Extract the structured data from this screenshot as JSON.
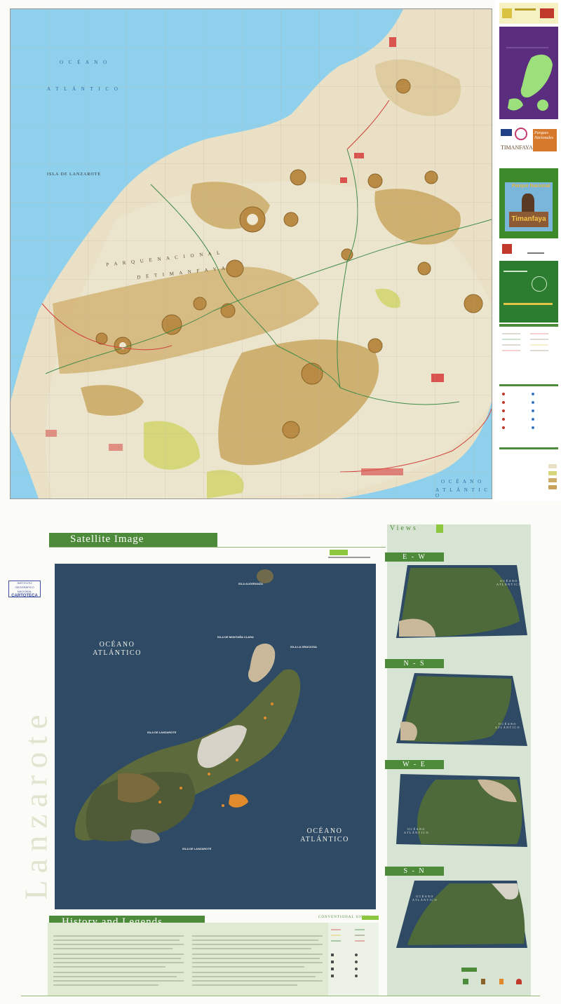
{
  "top_map": {
    "ocean_north_line1": "O C É A N O",
    "ocean_north_line2": "A T L Á N T I C O",
    "island_label": "ISLA DE LANZAROTE",
    "park_line1": "P A R Q U E   N A C I O N A L",
    "park_line2": "D E   T I M A N F A Y A",
    "ocean_south_line1": "O C É A N O",
    "ocean_south_line2": "A T L Á N T I C O"
  },
  "sidebar": {
    "timanfaya_text": "TIMANFAYA",
    "parques_line1": "Parques",
    "parques_line2": "Nacionales",
    "photo_sign": "Timanfaya",
    "photo_banner": "Parque Nacional"
  },
  "bottom": {
    "vertical_title": "Lanzarote",
    "satellite_title": "Satellite Image",
    "history_title": "History and Legends",
    "views_title": "Views",
    "cartoteca_stamp": [
      "INSTITUTO GEOGRÁFICO",
      "NACIONAL",
      "CARTOTECA"
    ],
    "legend_tab": "CONVENTIONAL SIGNS"
  },
  "satellite": {
    "ocean_left": [
      "OCÉANO",
      "ATLÁNTICO"
    ],
    "ocean_right": [
      "OCÉANO",
      "ATLÁNTICO"
    ],
    "isla_alegranza": "ISLA ALEGRANZA",
    "isla_montana_clara": "ISLA DE MONTAÑA CLARA",
    "isla_graciosa": "ISLA LA GRACIOSA",
    "isla_lanzarote_n": "ISLA DE LANZAROTE",
    "isla_lanzarote_s": "ISLA DE LANZAROTE"
  },
  "views": [
    {
      "label": "E - W",
      "ocean": [
        "OCÉANO",
        "ATLÁNTICO"
      ]
    },
    {
      "label": "N - S",
      "ocean": [
        "OCÉANO",
        "ATLÁNTICO"
      ]
    },
    {
      "label": "W - E",
      "ocean": [
        "OCÉANO",
        "ATLÁNTICO"
      ]
    },
    {
      "label": "S - N",
      "ocean": [
        "OCÉANO",
        "ATLÁNTICO"
      ]
    }
  ],
  "colors": {
    "ocean": "#8fd0ec",
    "land": "#e9e0c5",
    "volcano": "#c7a35a",
    "green_band": "#4d8a3a",
    "sidebar_purple": "#5b2d7f",
    "sidebar_green": "#2c7d2f",
    "sat_sea": "#2e4a64"
  }
}
